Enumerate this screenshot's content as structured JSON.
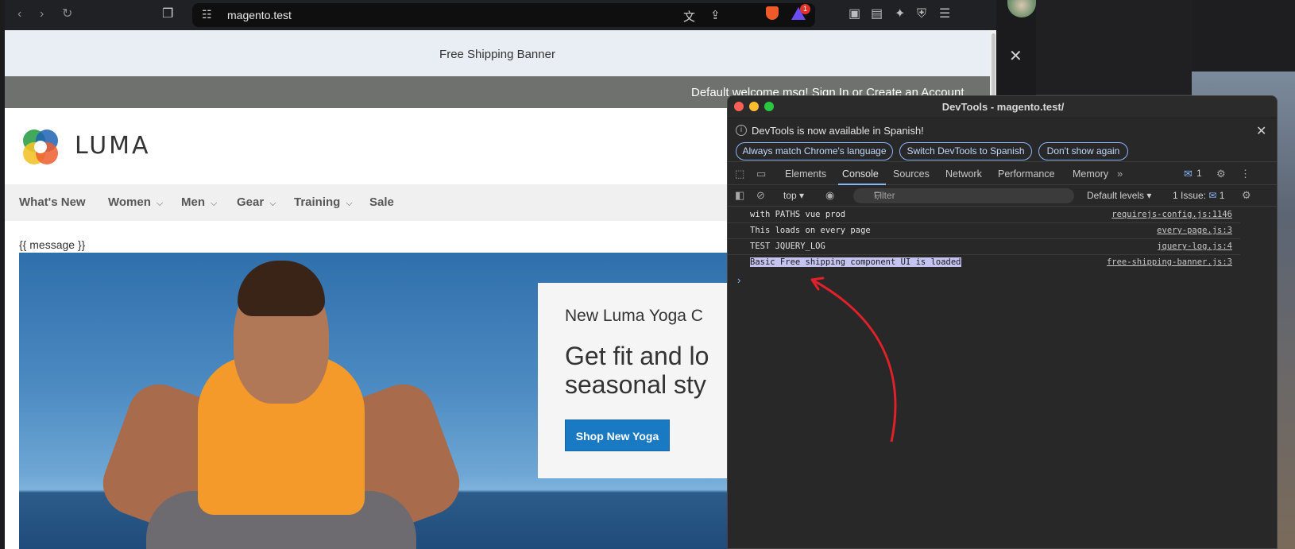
{
  "browser": {
    "url": "magento.test",
    "rewards_badge": "1"
  },
  "page": {
    "shipping_banner": "Free Shipping Banner",
    "welcome": "Default welcome msg!  Sign In  or  Create an Account",
    "logo_text": "LUMA",
    "nav": [
      "What's New",
      "Women",
      "Men",
      "Gear",
      "Training",
      "Sale"
    ],
    "message_placeholder": "{{ message }}",
    "promo": {
      "subtitle": "New Luma Yoga C",
      "title_line1": "Get fit and lo",
      "title_line2": "seasonal sty",
      "button": "Shop New Yoga"
    }
  },
  "side_panel": {
    "close": "✕"
  },
  "devtools": {
    "title": "DevTools - magento.test/",
    "info": {
      "text": "DevTools is now available in Spanish!",
      "buttons": [
        "Always match Chrome's language",
        "Switch DevTools to Spanish",
        "Don't show again"
      ]
    },
    "tabs": [
      "Elements",
      "Console",
      "Sources",
      "Network",
      "Performance",
      "Memory"
    ],
    "active_tab": "Console",
    "issues_badge": "1",
    "context": "top ▾",
    "filter_placeholder": "Filter",
    "levels": "Default levels ▾",
    "issues_text": "1 Issue:",
    "issues_count": "1",
    "logs": [
      {
        "message": "with PATHS vue prod",
        "source": "requirejs-config.js:1146"
      },
      {
        "message": "This loads on every page",
        "source": "every-page.js:3"
      },
      {
        "message": "TEST JQUERY_LOG",
        "source": "jquery-log.js:4"
      },
      {
        "message": "Basic Free shipping component UI is loaded",
        "source": "free-shipping-banner.js:3"
      }
    ],
    "prompt": "›"
  },
  "colors": {
    "accent_blue": "#1979c3",
    "devtools_accent": "#8ab4f8",
    "annotation_arrow": "#e0202a",
    "highlight": "#c5c3f0"
  }
}
